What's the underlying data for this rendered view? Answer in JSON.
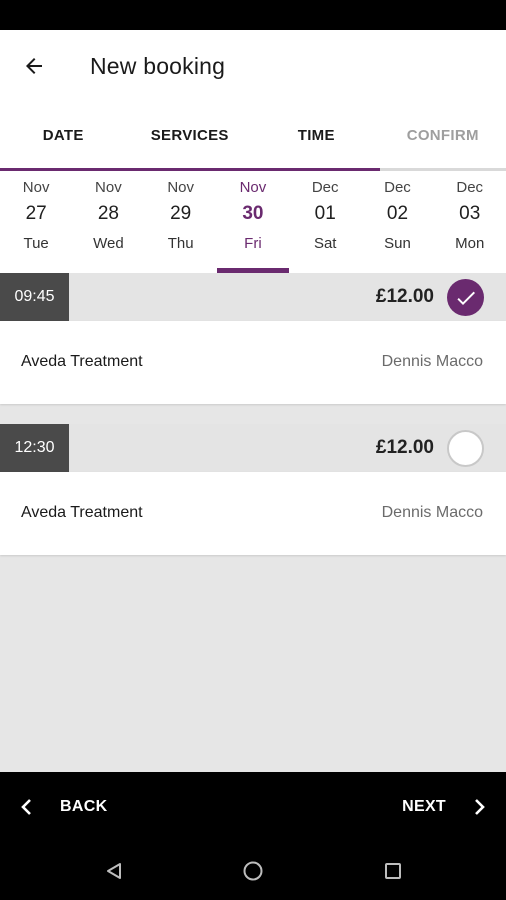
{
  "app_bar": {
    "title": "New booking"
  },
  "tabs": [
    {
      "label": "DATE"
    },
    {
      "label": "SERVICES"
    },
    {
      "label": "TIME"
    },
    {
      "label": "CONFIRM"
    }
  ],
  "progress": 0.75,
  "dates": [
    {
      "month": "Nov",
      "day": "27",
      "weekday": "Tue"
    },
    {
      "month": "Nov",
      "day": "28",
      "weekday": "Wed"
    },
    {
      "month": "Nov",
      "day": "29",
      "weekday": "Thu"
    },
    {
      "month": "Nov",
      "day": "30",
      "weekday": "Fri"
    },
    {
      "month": "Dec",
      "day": "01",
      "weekday": "Sat"
    },
    {
      "month": "Dec",
      "day": "02",
      "weekday": "Sun"
    },
    {
      "month": "Dec",
      "day": "03",
      "weekday": "Mon"
    }
  ],
  "selected_date_index": 3,
  "slots": [
    {
      "time": "09:45",
      "price": "£12.00",
      "service": "Aveda Treatment",
      "staff": "Dennis Macco",
      "selected": true
    },
    {
      "time": "12:30",
      "price": "£12.00",
      "service": "Aveda Treatment",
      "staff": "Dennis Macco",
      "selected": false
    }
  ],
  "footer": {
    "back_label": "BACK",
    "next_label": "NEXT"
  },
  "colors": {
    "accent": "#6a2a6f",
    "time_badge": "#4a4a4a",
    "background": "#e6e6e6"
  },
  "icons": {
    "back": "arrow-left-icon",
    "check": "check-icon",
    "prev": "chevron-left-icon",
    "next": "chevron-right-icon",
    "nav_back": "triangle-back-icon",
    "nav_home": "circle-home-icon",
    "nav_recents": "square-recents-icon"
  }
}
